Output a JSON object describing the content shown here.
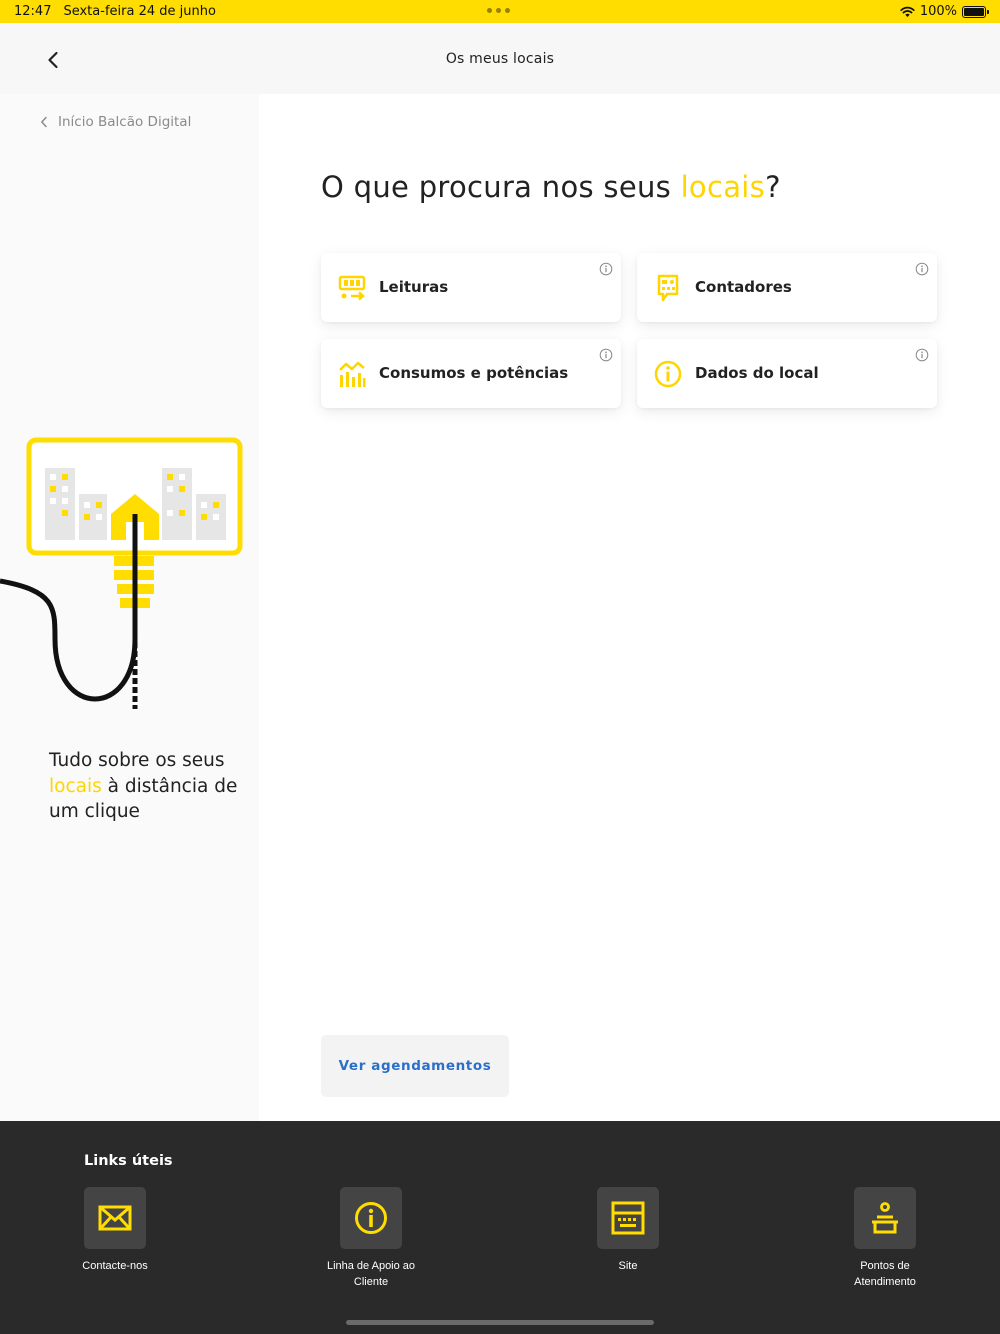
{
  "status_bar": {
    "time": "12:47",
    "date": "Sexta-feira 24 de junho",
    "battery": "100%",
    "wifi_icon": "wifi-icon",
    "battery_level": 1.0
  },
  "nav": {
    "title": "Os meus locais",
    "back_icon": "chevron-left-icon"
  },
  "sidebar": {
    "breadcrumb": "Início Balcão Digital",
    "tagline_before": "Tudo sobre os seus ",
    "tagline_accent": "locais",
    "tagline_after": " à distância de um clique"
  },
  "main": {
    "heading_before": "O que procura nos seus ",
    "heading_accent": "locais",
    "heading_after": "?",
    "cards": [
      {
        "label": "Leituras",
        "icon": "meter-reading-icon"
      },
      {
        "label": "Contadores",
        "icon": "counter-icon"
      },
      {
        "label": "Consumos e potências",
        "icon": "consumption-chart-icon"
      },
      {
        "label": "Dados do local",
        "icon": "info-circle-icon"
      }
    ],
    "schedule_button": "Ver agendamentos"
  },
  "footer": {
    "title": "Links úteis",
    "links": [
      {
        "label": "Contacte-nos",
        "icon": "envelope-icon"
      },
      {
        "label": "Linha de Apoio ao Cliente",
        "icon": "info-circle-icon"
      },
      {
        "label": "Site",
        "icon": "keyboard-screen-icon"
      },
      {
        "label": "Pontos de Atendimento",
        "icon": "service-desk-icon"
      }
    ]
  },
  "colors": {
    "accent": "#FFDD00",
    "link": "#2b6fc8",
    "footer_bg": "#2a2a2a",
    "sidebar_bg": "#fafafa"
  }
}
